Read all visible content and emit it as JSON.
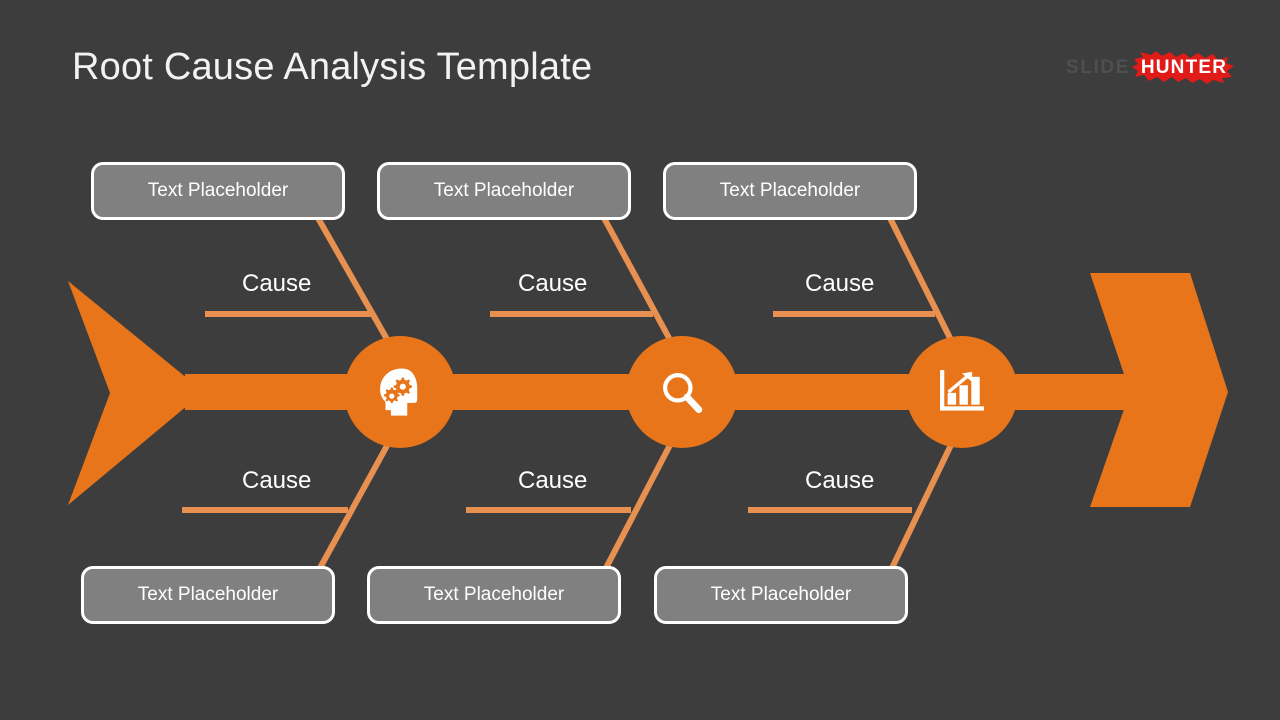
{
  "page": {
    "background_color": "#3d3d3d",
    "title": "Root Cause Analysis Template"
  },
  "logo": {
    "slide_text": "SLIDE",
    "hunter_text": "HUNTER",
    "splat_color": "#e01b18",
    "slide_color": "#4f4f4f",
    "hunter_color": "#ffffff"
  },
  "colors": {
    "spine_orange": "#e8751a",
    "bone_orange": "#e8904f",
    "box_fill": "#808080",
    "box_border": "#ffffff",
    "text_white": "#ffffff"
  },
  "diagram": {
    "type": "fishbone-root-cause-analysis",
    "spine_label": "main-spine-arrow",
    "categories": [
      {
        "index": 1,
        "icon": "head-gears-icon",
        "icon_meaning": "thinking-head-with-gears",
        "top_box": "Text Placeholder",
        "bottom_box": "Text Placeholder",
        "top_cause": "Cause",
        "bottom_cause": "Cause"
      },
      {
        "index": 2,
        "icon": "magnifier-icon",
        "icon_meaning": "search-magnifying-glass",
        "top_box": "Text Placeholder",
        "bottom_box": "Text Placeholder",
        "top_cause": "Cause",
        "bottom_cause": "Cause"
      },
      {
        "index": 3,
        "icon": "bar-chart-arrow-icon",
        "icon_meaning": "growth-bar-chart-with-arrow",
        "top_box": "Text Placeholder",
        "bottom_box": "Text Placeholder",
        "top_cause": "Cause",
        "bottom_cause": "Cause"
      }
    ]
  },
  "boxes": {
    "top": [
      {
        "label": "Text Placeholder"
      },
      {
        "label": "Text Placeholder"
      },
      {
        "label": "Text Placeholder"
      }
    ],
    "bottom": [
      {
        "label": "Text Placeholder"
      },
      {
        "label": "Text Placeholder"
      },
      {
        "label": "Text Placeholder"
      }
    ]
  },
  "causes": {
    "top": [
      "Cause",
      "Cause",
      "Cause"
    ],
    "bottom": [
      "Cause",
      "Cause",
      "Cause"
    ]
  }
}
